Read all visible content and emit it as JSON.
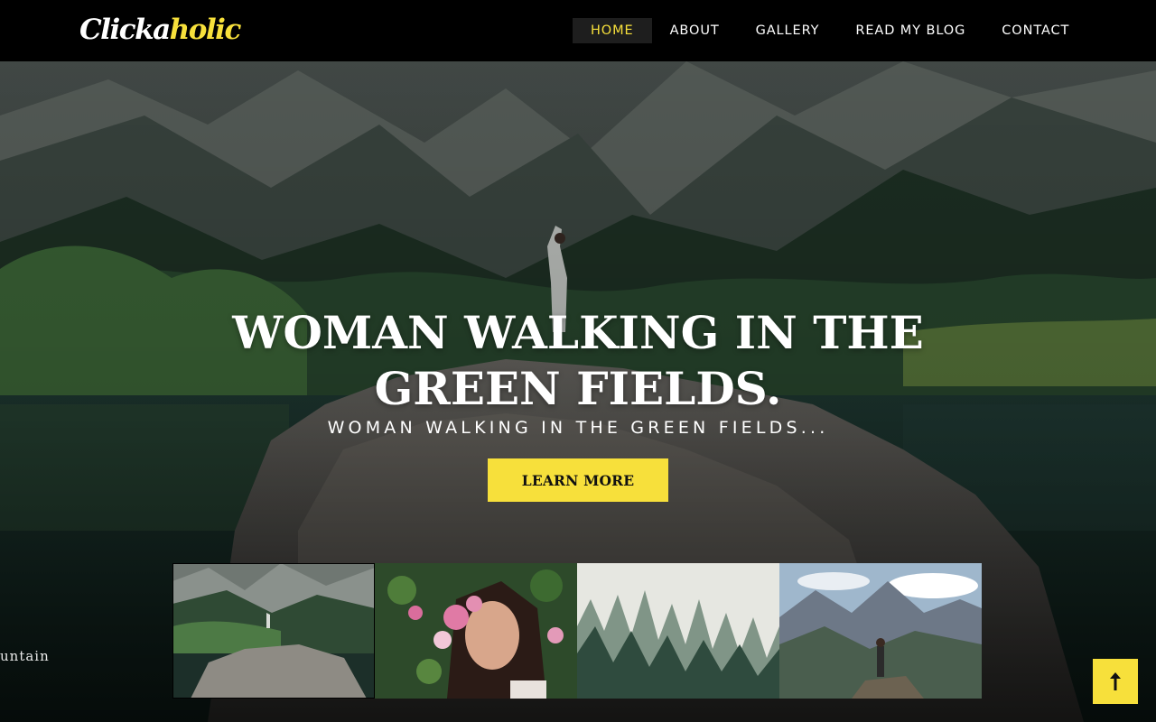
{
  "brand": {
    "logo_part1": "Clicka",
    "logo_part2": "holic"
  },
  "nav": {
    "items": [
      {
        "label": "HOME",
        "active": true
      },
      {
        "label": "ABOUT",
        "active": false
      },
      {
        "label": "GALLERY",
        "active": false
      },
      {
        "label": "READ MY BLOG",
        "active": false
      },
      {
        "label": "CONTACT",
        "active": false
      }
    ]
  },
  "hero": {
    "title": "WOMAN WALKING IN THE GREEN FIELDS.",
    "subtitle": "WOMAN WALKING IN THE GREEN FIELDS...",
    "button_label": "LEARN MORE",
    "side_caption": "untain"
  },
  "gallery": {
    "thumbnails": [
      {
        "name": "thumb-mountain-lake",
        "active": true
      },
      {
        "name": "thumb-woman-flowers",
        "active": false
      },
      {
        "name": "thumb-misty-forest",
        "active": false
      },
      {
        "name": "thumb-hiker-peak",
        "active": false
      }
    ]
  },
  "scroll_top": {
    "icon": "arrow-up-icon"
  },
  "colors": {
    "accent": "#f7e03b",
    "header_bg": "#000000",
    "nav_active_bg": "#1e1e1e",
    "text": "#ffffff"
  }
}
